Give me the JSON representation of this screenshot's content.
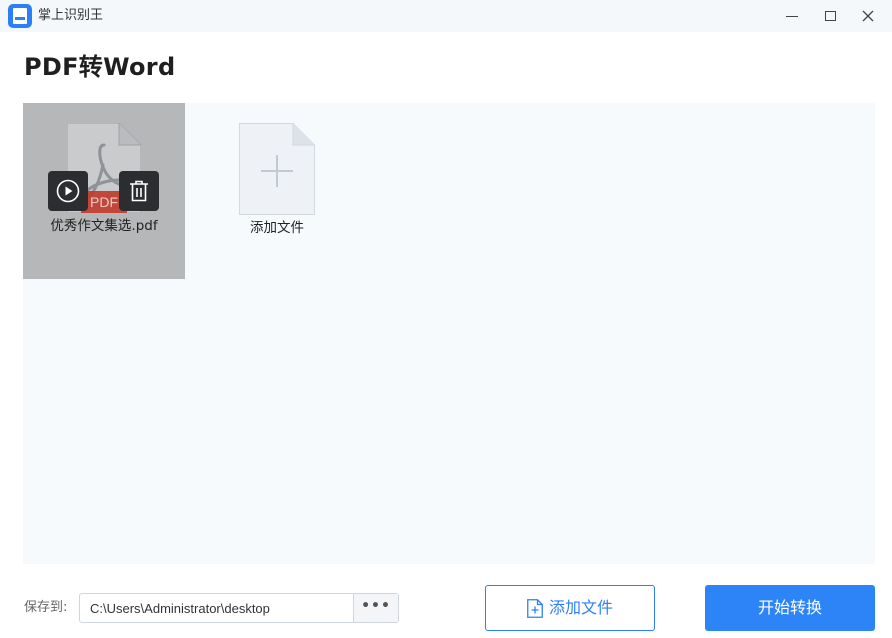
{
  "window": {
    "title": "掌上识别王"
  },
  "page": {
    "title": "PDF转Word"
  },
  "files": [
    {
      "name": "优秀作文集选.pdf",
      "type_badge": "PDF"
    }
  ],
  "add_placeholder": {
    "label": "添加文件"
  },
  "footer": {
    "save_label": "保存到:",
    "save_path": "C:\\Users\\Administrator\\desktop",
    "browse_label": "•••",
    "add_file_label": "添加文件",
    "start_label": "开始转换"
  },
  "colors": {
    "accent": "#2d84f7",
    "pdf_badge": "#c0392b"
  },
  "icons": {
    "app": "app-logo-icon",
    "play": "play-icon",
    "delete": "trash-icon",
    "add_doc": "plus-document-icon",
    "add_file": "add-file-icon"
  }
}
